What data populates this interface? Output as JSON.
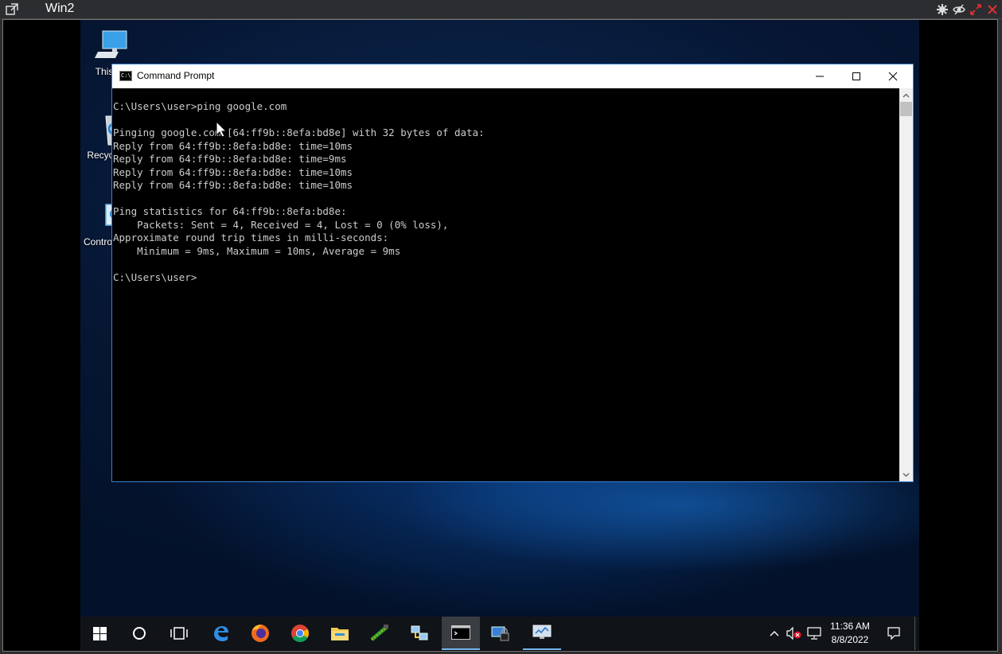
{
  "viewer": {
    "title": "Win2",
    "tools": [
      "settings-icon",
      "hide-icon",
      "fullscreen-icon",
      "close-icon"
    ]
  },
  "desktop": {
    "icons": [
      {
        "label": "This PC",
        "icon": "this-pc-icon"
      },
      {
        "label": "Recycle Bin",
        "icon": "recycle-bin-icon"
      },
      {
        "label": "Control Panel",
        "icon": "control-panel-icon"
      }
    ]
  },
  "cmd": {
    "title": "Command Prompt",
    "icon_text": "C:\\",
    "lines": [
      "C:\\Users\\user>ping google.com",
      "",
      "Pinging google.com [64:ff9b::8efa:bd8e] with 32 bytes of data:",
      "Reply from 64:ff9b::8efa:bd8e: time=10ms",
      "Reply from 64:ff9b::8efa:bd8e: time=9ms",
      "Reply from 64:ff9b::8efa:bd8e: time=10ms",
      "Reply from 64:ff9b::8efa:bd8e: time=10ms",
      "",
      "Ping statistics for 64:ff9b::8efa:bd8e:",
      "    Packets: Sent = 4, Received = 4, Lost = 0 (0% loss),",
      "Approximate round trip times in milli-seconds:",
      "    Minimum = 9ms, Maximum = 10ms, Average = 9ms",
      "",
      "C:\\Users\\user>"
    ]
  },
  "taskbar": {
    "items": [
      {
        "name": "start-button",
        "icon": "windows-icon"
      },
      {
        "name": "search-button",
        "icon": "cortana-circle-icon"
      },
      {
        "name": "task-view-button",
        "icon": "task-view-icon"
      },
      {
        "name": "edge-button",
        "icon": "edge-icon"
      },
      {
        "name": "firefox-button",
        "icon": "firefox-icon"
      },
      {
        "name": "chrome-button",
        "icon": "chrome-icon"
      },
      {
        "name": "file-explorer-button",
        "icon": "folder-icon"
      },
      {
        "name": "network-cable-button",
        "icon": "cable-icon"
      },
      {
        "name": "network-button",
        "icon": "network-computers-icon"
      },
      {
        "name": "command-prompt-button",
        "icon": "cmd-icon"
      },
      {
        "name": "security-app-button",
        "icon": "lock-computer-icon"
      },
      {
        "name": "monitor-app-button",
        "icon": "monitor-icon"
      }
    ],
    "tray": {
      "time": "11:36 AM",
      "date": "8/8/2022",
      "icons": [
        "chevron-up-icon",
        "volume-muted-icon",
        "network-icon",
        "action-center-icon"
      ]
    }
  },
  "colors": {
    "console_text": "#cccccc",
    "console_bg": "#000000",
    "window_border": "#3a7fd6",
    "taskbar_accent": "#76b9ed"
  }
}
